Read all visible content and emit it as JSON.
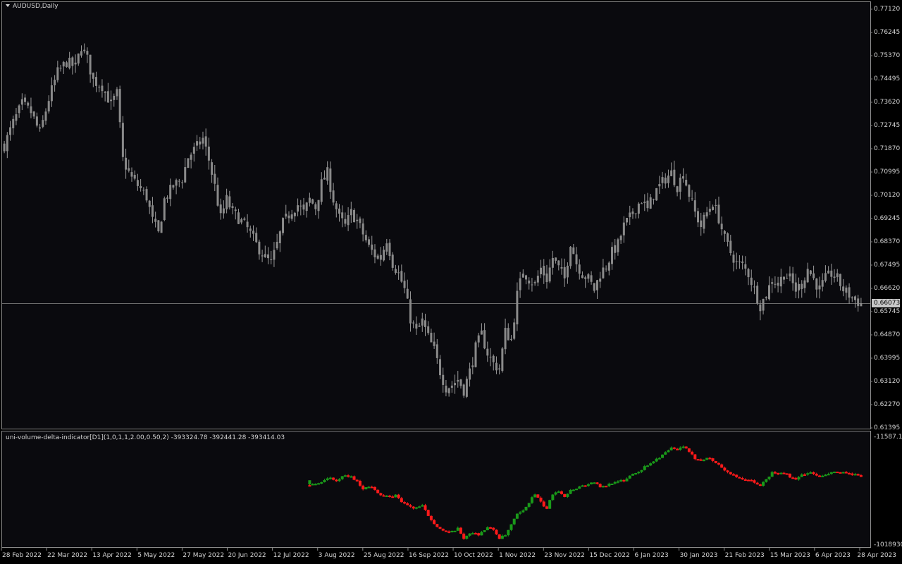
{
  "chart": {
    "symbol_label": "AUDUSD,Daily",
    "current_price": "0.66073",
    "price_axis": [
      "0.77120",
      "0.76245",
      "0.75370",
      "0.74495",
      "0.73620",
      "0.72745",
      "0.71870",
      "0.70995",
      "0.70120",
      "0.69245",
      "0.68370",
      "0.67495",
      "0.66620",
      "0.65745",
      "0.64870",
      "0.63995",
      "0.63120",
      "0.62270",
      "0.61395"
    ],
    "date_axis": [
      "28 Feb 2022",
      "22 Mar 2022",
      "13 Apr 2022",
      "5 May 2022",
      "27 May 2022",
      "20 Jun 2022",
      "12 Jul 2022",
      "3 Aug 2022",
      "25 Aug 2022",
      "16 Sep 2022",
      "10 Oct 2022",
      "1 Nov 2022",
      "23 Nov 2022",
      "15 Dec 2022",
      "6 Jan 2023",
      "30 Jan 2023",
      "21 Feb 2023",
      "15 Mar 2023",
      "6 Apr 2023",
      "28 Apr 2023"
    ],
    "colors": {
      "background": "#0a0a0e",
      "candle": "#8a8a8a",
      "wick": "#9a9a9a",
      "delta_up": "#1a9a1a",
      "delta_down": "#ff1a1a",
      "frame": "#8c8c8c",
      "text": "#d4d4d4"
    }
  },
  "indicator": {
    "label": "uni-volume-delta-indicator[D1](1,0,1,1,2.00,0.50,2) -393324.78 -392441.28 -393414.03",
    "axis_top": "-11587.15",
    "axis_bottom": "-1018930.4"
  },
  "chart_data": {
    "type": "candlestick",
    "price_ylim": [
      0.6137,
      0.7722
    ],
    "close_path": [
      [
        0,
        0.7205
      ],
      [
        3,
        0.729
      ],
      [
        6,
        0.736
      ],
      [
        9,
        0.733
      ],
      [
        12,
        0.725
      ],
      [
        15,
        0.738
      ],
      [
        18,
        0.748
      ],
      [
        21,
        0.752
      ],
      [
        24,
        0.75
      ],
      [
        26,
        0.758
      ],
      [
        28,
        0.753
      ],
      [
        30,
        0.745
      ],
      [
        33,
        0.743
      ],
      [
        36,
        0.736
      ],
      [
        38,
        0.74
      ],
      [
        40,
        0.715
      ],
      [
        43,
        0.708
      ],
      [
        46,
        0.704
      ],
      [
        48,
        0.701
      ],
      [
        50,
        0.692
      ],
      [
        52,
        0.687
      ],
      [
        54,
        0.7
      ],
      [
        57,
        0.705
      ],
      [
        60,
        0.708
      ],
      [
        62,
        0.716
      ],
      [
        65,
        0.72
      ],
      [
        67,
        0.723
      ],
      [
        69,
        0.715
      ],
      [
        71,
        0.705
      ],
      [
        73,
        0.693
      ],
      [
        75,
        0.7
      ],
      [
        77,
        0.695
      ],
      [
        79,
        0.693
      ],
      [
        82,
        0.689
      ],
      [
        85,
        0.683
      ],
      [
        88,
        0.678
      ],
      [
        90,
        0.676
      ],
      [
        92,
        0.683
      ],
      [
        94,
        0.691
      ],
      [
        97,
        0.696
      ],
      [
        99,
        0.698
      ],
      [
        101,
        0.695
      ],
      [
        103,
        0.7
      ],
      [
        105,
        0.697
      ],
      [
        107,
        0.706
      ],
      [
        109,
        0.71
      ],
      [
        111,
        0.7
      ],
      [
        113,
        0.693
      ],
      [
        115,
        0.69
      ],
      [
        117,
        0.695
      ],
      [
        119,
        0.692
      ],
      [
        121,
        0.687
      ],
      [
        123,
        0.682
      ],
      [
        125,
        0.679
      ],
      [
        127,
        0.678
      ],
      [
        129,
        0.685
      ],
      [
        131,
        0.676
      ],
      [
        133,
        0.672
      ],
      [
        135,
        0.666
      ],
      [
        137,
        0.655
      ],
      [
        139,
        0.65
      ],
      [
        141,
        0.654
      ],
      [
        143,
        0.648
      ],
      [
        145,
        0.643
      ],
      [
        147,
        0.635
      ],
      [
        149,
        0.629
      ],
      [
        151,
        0.63
      ],
      [
        153,
        0.632
      ],
      [
        155,
        0.628
      ],
      [
        157,
        0.635
      ],
      [
        159,
        0.644
      ],
      [
        161,
        0.649
      ],
      [
        163,
        0.642
      ],
      [
        165,
        0.638
      ],
      [
        167,
        0.636
      ],
      [
        169,
        0.65
      ],
      [
        171,
        0.647
      ],
      [
        173,
        0.664
      ],
      [
        175,
        0.673
      ],
      [
        177,
        0.67
      ],
      [
        179,
        0.668
      ],
      [
        181,
        0.674
      ],
      [
        183,
        0.67
      ],
      [
        185,
        0.678
      ],
      [
        187,
        0.674
      ],
      [
        189,
        0.67
      ],
      [
        191,
        0.684
      ],
      [
        193,
        0.676
      ],
      [
        195,
        0.672
      ],
      [
        197,
        0.67
      ],
      [
        199,
        0.666
      ],
      [
        201,
        0.672
      ],
      [
        203,
        0.675
      ],
      [
        205,
        0.68
      ],
      [
        207,
        0.683
      ],
      [
        209,
        0.69
      ],
      [
        211,
        0.693
      ],
      [
        213,
        0.697
      ],
      [
        215,
        0.7
      ],
      [
        217,
        0.696
      ],
      [
        219,
        0.702
      ],
      [
        221,
        0.705
      ],
      [
        223,
        0.708
      ],
      [
        225,
        0.71
      ],
      [
        227,
        0.705
      ],
      [
        229,
        0.71
      ],
      [
        231,
        0.702
      ],
      [
        233,
        0.695
      ],
      [
        235,
        0.69
      ],
      [
        237,
        0.695
      ],
      [
        239,
        0.699
      ],
      [
        241,
        0.693
      ],
      [
        243,
        0.685
      ],
      [
        245,
        0.68
      ],
      [
        247,
        0.676
      ],
      [
        249,
        0.675
      ],
      [
        251,
        0.672
      ],
      [
        253,
        0.666
      ],
      [
        255,
        0.66
      ],
      [
        257,
        0.664
      ],
      [
        259,
        0.67
      ],
      [
        261,
        0.668
      ],
      [
        263,
        0.672
      ],
      [
        265,
        0.67
      ],
      [
        267,
        0.666
      ],
      [
        269,
        0.668
      ],
      [
        271,
        0.674
      ],
      [
        273,
        0.67
      ],
      [
        275,
        0.666
      ],
      [
        277,
        0.67
      ],
      [
        279,
        0.672
      ],
      [
        281,
        0.67
      ],
      [
        283,
        0.666
      ],
      [
        285,
        0.664
      ],
      [
        287,
        0.662
      ],
      [
        289,
        0.6607
      ]
    ],
    "delta_start_index": 103,
    "delta_path": [
      [
        103,
        -168000
      ],
      [
        106,
        -160000
      ],
      [
        109,
        -140000
      ],
      [
        112,
        -150000
      ],
      [
        115,
        -132000
      ],
      [
        117,
        -135000
      ],
      [
        119,
        -155000
      ],
      [
        121,
        -180000
      ],
      [
        124,
        -172000
      ],
      [
        127,
        -205000
      ],
      [
        130,
        -215000
      ],
      [
        132,
        -207000
      ],
      [
        135,
        -240000
      ],
      [
        138,
        -255000
      ],
      [
        141,
        -248000
      ],
      [
        144,
        -300000
      ],
      [
        147,
        -335000
      ],
      [
        150,
        -352000
      ],
      [
        153,
        -335000
      ],
      [
        155,
        -370000
      ],
      [
        157,
        -350000
      ],
      [
        160,
        -355000
      ],
      [
        163,
        -330000
      ],
      [
        165,
        -338000
      ],
      [
        167,
        -370000
      ],
      [
        169,
        -360000
      ],
      [
        171,
        -320000
      ],
      [
        173,
        -280000
      ],
      [
        175,
        -268000
      ],
      [
        177,
        -232000
      ],
      [
        179,
        -202000
      ],
      [
        181,
        -235000
      ],
      [
        183,
        -258000
      ],
      [
        185,
        -200000
      ],
      [
        187,
        -188000
      ],
      [
        189,
        -210000
      ],
      [
        191,
        -188000
      ],
      [
        193,
        -178000
      ],
      [
        195,
        -170000
      ],
      [
        197,
        -165000
      ],
      [
        199,
        -155000
      ],
      [
        201,
        -178000
      ],
      [
        203,
        -170000
      ],
      [
        205,
        -158000
      ],
      [
        207,
        -150000
      ],
      [
        209,
        -155000
      ],
      [
        211,
        -130000
      ],
      [
        213,
        -120000
      ],
      [
        215,
        -108000
      ],
      [
        217,
        -90000
      ],
      [
        219,
        -75000
      ],
      [
        221,
        -60000
      ],
      [
        223,
        -45000
      ],
      [
        225,
        -28000
      ],
      [
        227,
        -35000
      ],
      [
        229,
        -18000
      ],
      [
        231,
        -45000
      ],
      [
        233,
        -65000
      ],
      [
        235,
        -72000
      ],
      [
        237,
        -62000
      ],
      [
        239,
        -75000
      ],
      [
        241,
        -90000
      ],
      [
        243,
        -110000
      ],
      [
        245,
        -125000
      ],
      [
        247,
        -140000
      ],
      [
        249,
        -148000
      ],
      [
        251,
        -145000
      ],
      [
        253,
        -160000
      ],
      [
        255,
        -168000
      ],
      [
        257,
        -148000
      ],
      [
        259,
        -120000
      ],
      [
        261,
        -125000
      ],
      [
        263,
        -120000
      ],
      [
        265,
        -135000
      ],
      [
        267,
        -150000
      ],
      [
        269,
        -128000
      ],
      [
        271,
        -120000
      ],
      [
        273,
        -125000
      ],
      [
        275,
        -135000
      ],
      [
        277,
        -132000
      ],
      [
        279,
        -118000
      ],
      [
        281,
        -122000
      ],
      [
        283,
        -118000
      ],
      [
        285,
        -128000
      ],
      [
        287,
        -130000
      ],
      [
        289,
        -132000
      ]
    ],
    "delta_ylim": [
      -393500,
      -11587.15
    ],
    "delta_outlier": [
      103,
      -160000
    ]
  }
}
